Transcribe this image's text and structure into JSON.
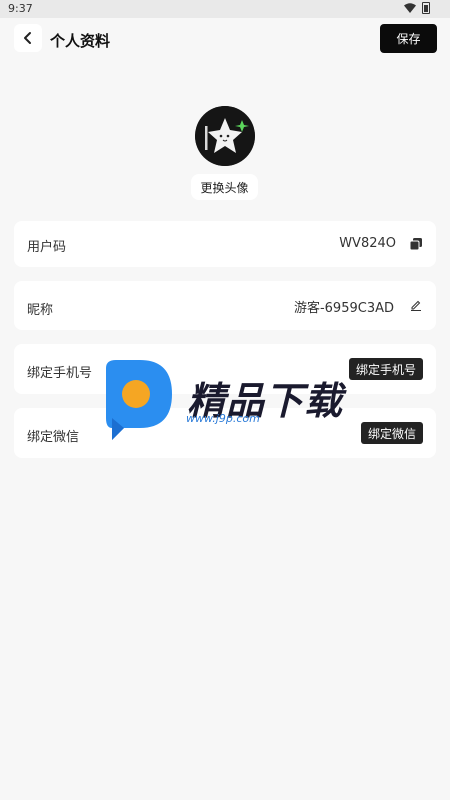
{
  "status_bar": {
    "time": "9:37"
  },
  "header": {
    "title": "个人资料",
    "save_label": "保存"
  },
  "avatar": {
    "change_label": "更换头像"
  },
  "profile": {
    "user_code": {
      "label": "用户码",
      "value": "WV824O"
    },
    "nickname": {
      "label": "昵称",
      "value": "游客-6959C3AD"
    },
    "phone": {
      "label": "绑定手机号",
      "button_label": "绑定手机号"
    },
    "wechat": {
      "label": "绑定微信",
      "button_label": "绑定微信"
    }
  },
  "watermark": {
    "text": "精品下载",
    "url": "www.j9p.com"
  },
  "colors": {
    "background": "#f7f7f7",
    "card": "#ffffff",
    "primary_button": "#0b0b0b",
    "bind_button": "#232323",
    "watermark_blue": "#2b7bd8",
    "watermark_orange": "#f5a623"
  }
}
